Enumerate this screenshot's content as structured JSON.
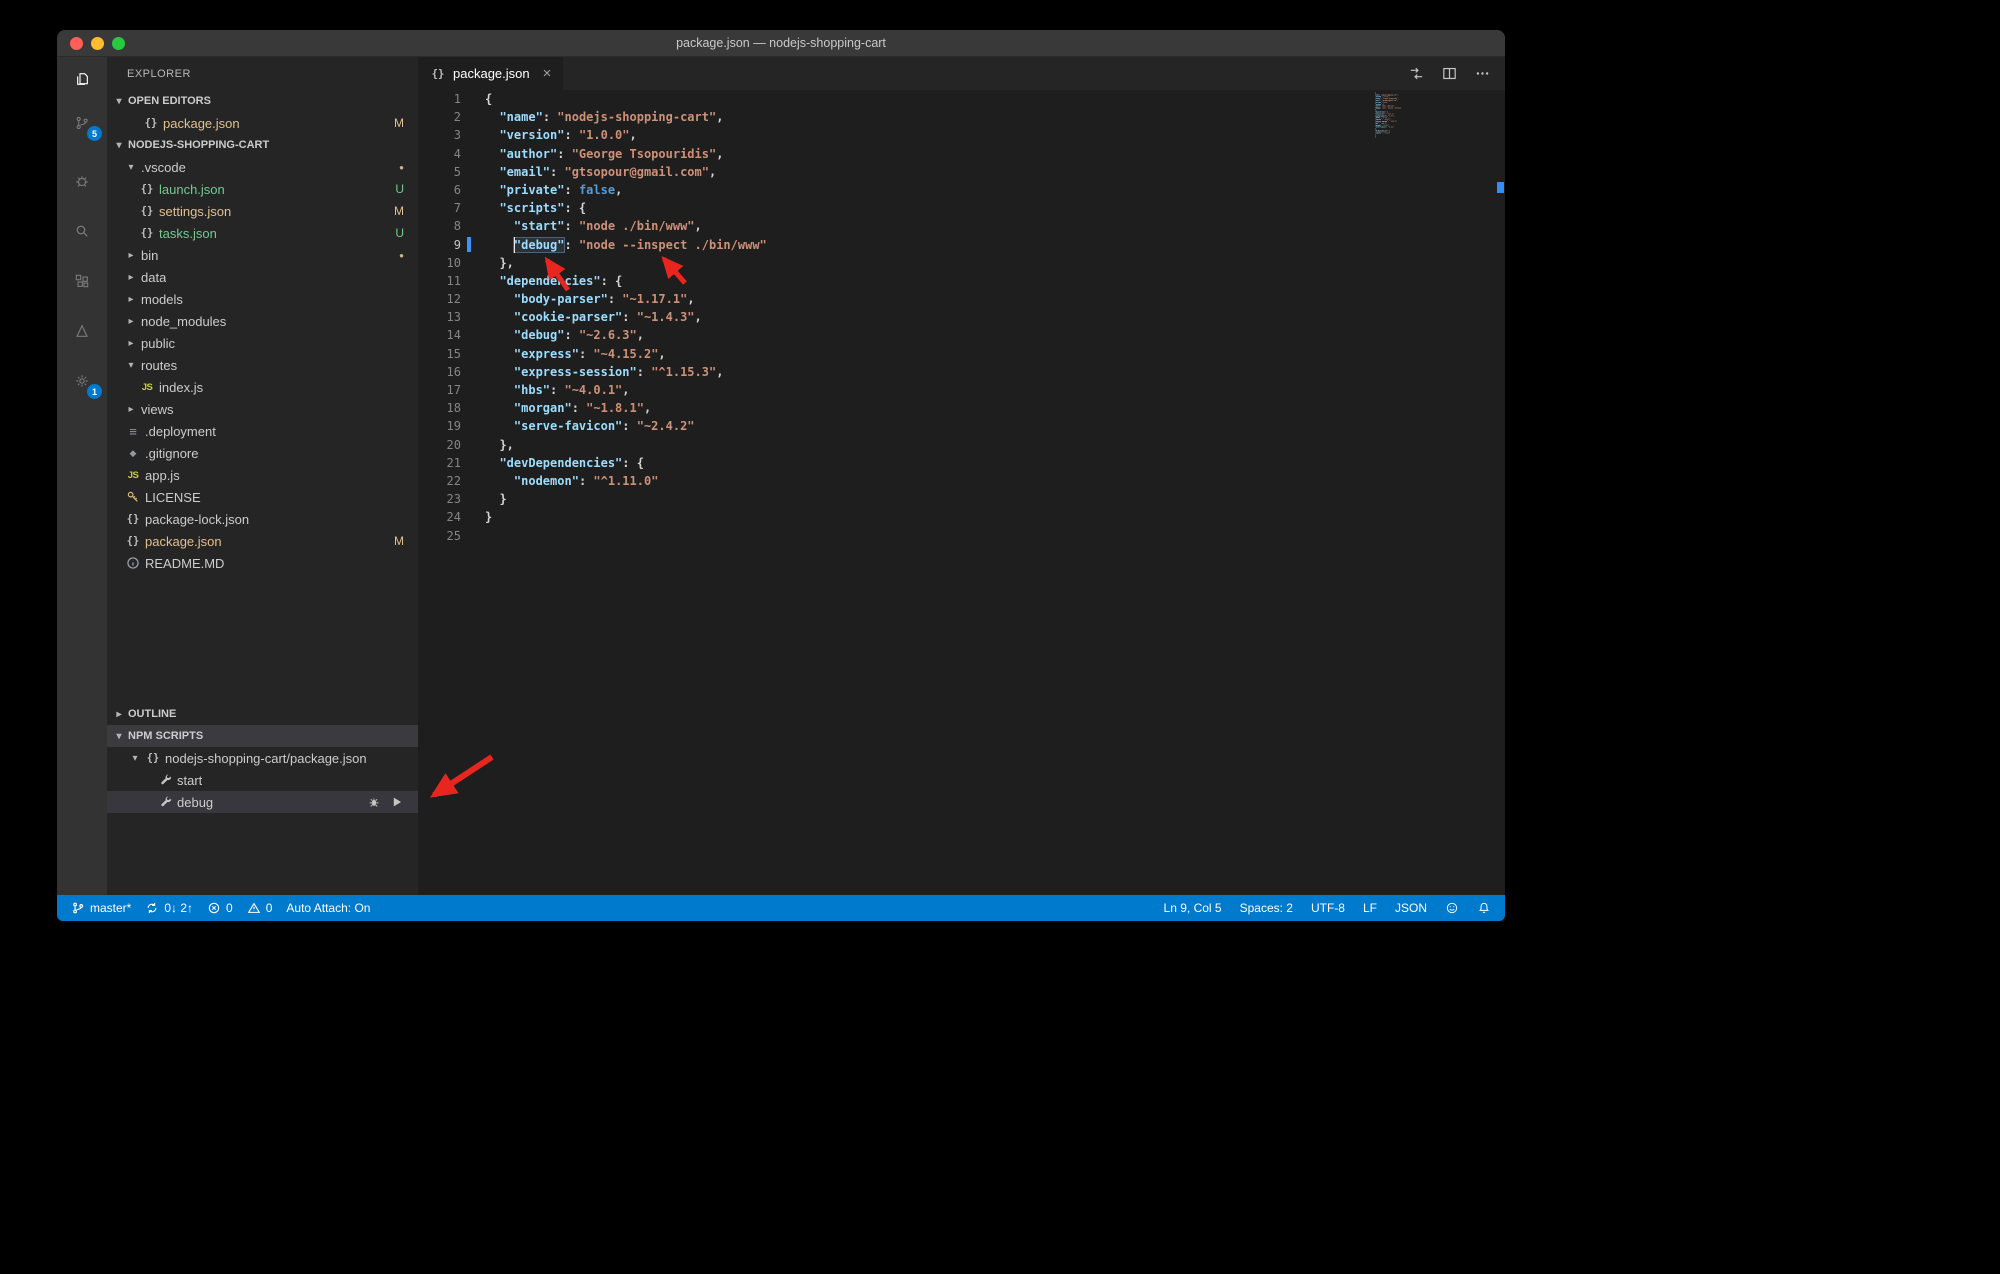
{
  "window": {
    "title": "package.json — nodejs-shopping-cart"
  },
  "activity_bar": {
    "items": [
      {
        "name": "explorer",
        "icon": "files-icon",
        "active": true
      },
      {
        "name": "source-control",
        "icon": "source-control-icon",
        "badge": "5"
      },
      {
        "name": "debug",
        "icon": "debug-icon"
      },
      {
        "name": "search",
        "icon": "search-icon"
      },
      {
        "name": "extensions",
        "icon": "extensions-icon"
      },
      {
        "name": "azure",
        "icon": "azure-icon"
      }
    ],
    "bottom": [
      {
        "name": "settings",
        "icon": "gear-icon",
        "badge": "1"
      }
    ]
  },
  "sidebar": {
    "title": "EXPLORER",
    "open_editors": {
      "label": "OPEN EDITORS",
      "items": [
        {
          "label": "package.json",
          "icon": "json",
          "badge": "M",
          "color": "modified"
        }
      ]
    },
    "project": {
      "label": "NODEJS-SHOPPING-CART",
      "items": [
        {
          "label": ".vscode",
          "type": "folder",
          "expanded": true,
          "indent": 0,
          "badge_dot": true
        },
        {
          "label": "launch.json",
          "icon": "json",
          "indent": 1,
          "badge": "U",
          "color": "untracked"
        },
        {
          "label": "settings.json",
          "icon": "json",
          "indent": 1,
          "badge": "M",
          "color": "modified"
        },
        {
          "label": "tasks.json",
          "icon": "json",
          "indent": 1,
          "badge": "U",
          "color": "untracked"
        },
        {
          "label": "bin",
          "type": "folder",
          "indent": 0,
          "badge_dot": true
        },
        {
          "label": "data",
          "type": "folder",
          "indent": 0
        },
        {
          "label": "models",
          "type": "folder",
          "indent": 0
        },
        {
          "label": "node_modules",
          "type": "folder",
          "indent": 0
        },
        {
          "label": "public",
          "type": "folder",
          "indent": 0
        },
        {
          "label": "routes",
          "type": "folder",
          "expanded": true,
          "indent": 0
        },
        {
          "label": "index.js",
          "icon": "js",
          "indent": 1
        },
        {
          "label": "views",
          "type": "folder",
          "indent": 0
        },
        {
          "label": ".deployment",
          "icon": "list",
          "indent": 0
        },
        {
          "label": ".gitignore",
          "icon": "diamond",
          "indent": 0
        },
        {
          "label": "app.js",
          "icon": "js",
          "indent": 0
        },
        {
          "label": "LICENSE",
          "icon": "key",
          "indent": 0
        },
        {
          "label": "package-lock.json",
          "icon": "json",
          "indent": 0
        },
        {
          "label": "package.json",
          "icon": "json",
          "indent": 0,
          "badge": "M",
          "color": "modified"
        },
        {
          "label": "README.MD",
          "icon": "info",
          "indent": 0
        }
      ]
    },
    "outline": {
      "label": "OUTLINE"
    },
    "npm_scripts": {
      "label": "NPM SCRIPTS",
      "items": [
        {
          "label": "nodejs-shopping-cart/package.json",
          "icon": "json",
          "expandable": true,
          "expanded": true,
          "indent": 0
        },
        {
          "label": "start",
          "icon": "wrench",
          "indent": 1
        },
        {
          "label": "debug",
          "icon": "wrench",
          "indent": 1,
          "selected": true,
          "actions": [
            "bug-icon",
            "play-icon"
          ]
        }
      ]
    }
  },
  "editor": {
    "tab": {
      "label": "package.json",
      "icon": "json",
      "close": "×"
    },
    "actions": [
      "open-changes-icon",
      "split-editor-icon",
      "more-icon"
    ],
    "active_line": 9,
    "cursor": {
      "line": 9,
      "col": 5
    },
    "lines": [
      {
        "n": 1,
        "t": [
          [
            "p",
            "{"
          ]
        ]
      },
      {
        "n": 2,
        "t": [
          [
            "p",
            "  "
          ],
          [
            "k",
            "\"name\""
          ],
          [
            "p",
            ": "
          ],
          [
            "s",
            "\"nodejs-shopping-cart\""
          ],
          [
            "p",
            ","
          ]
        ]
      },
      {
        "n": 3,
        "t": [
          [
            "p",
            "  "
          ],
          [
            "k",
            "\"version\""
          ],
          [
            "p",
            ": "
          ],
          [
            "s",
            "\"1.0.0\""
          ],
          [
            "p",
            ","
          ]
        ]
      },
      {
        "n": 4,
        "t": [
          [
            "p",
            "  "
          ],
          [
            "k",
            "\"author\""
          ],
          [
            "p",
            ": "
          ],
          [
            "s",
            "\"George Tsopouridis\""
          ],
          [
            "p",
            ","
          ]
        ]
      },
      {
        "n": 5,
        "t": [
          [
            "p",
            "  "
          ],
          [
            "k",
            "\"email\""
          ],
          [
            "p",
            ": "
          ],
          [
            "s",
            "\"gtsopour@gmail.com\""
          ],
          [
            "p",
            ","
          ]
        ]
      },
      {
        "n": 6,
        "t": [
          [
            "p",
            "  "
          ],
          [
            "k",
            "\"private\""
          ],
          [
            "p",
            ": "
          ],
          [
            "b",
            "false"
          ],
          [
            "p",
            ","
          ]
        ]
      },
      {
        "n": 7,
        "t": [
          [
            "p",
            "  "
          ],
          [
            "k",
            "\"scripts\""
          ],
          [
            "p",
            ": {"
          ]
        ]
      },
      {
        "n": 8,
        "t": [
          [
            "p",
            "    "
          ],
          [
            "k",
            "\"start\""
          ],
          [
            "p",
            ": "
          ],
          [
            "s",
            "\"node ./bin/www\""
          ],
          [
            "p",
            ","
          ]
        ]
      },
      {
        "n": 9,
        "t": [
          [
            "p",
            "    "
          ],
          [
            "k",
            "\"debug\"",
            "hl"
          ],
          [
            "p",
            ": "
          ],
          [
            "s",
            "\"node --inspect ./bin/www\""
          ]
        ]
      },
      {
        "n": 10,
        "t": [
          [
            "p",
            "  },"
          ]
        ]
      },
      {
        "n": 11,
        "t": [
          [
            "p",
            "  "
          ],
          [
            "k",
            "\"dependencies\""
          ],
          [
            "p",
            ": {"
          ]
        ]
      },
      {
        "n": 12,
        "t": [
          [
            "p",
            "    "
          ],
          [
            "k",
            "\"body-parser\""
          ],
          [
            "p",
            ": "
          ],
          [
            "s",
            "\"~1.17.1\""
          ],
          [
            "p",
            ","
          ]
        ]
      },
      {
        "n": 13,
        "t": [
          [
            "p",
            "    "
          ],
          [
            "k",
            "\"cookie-parser\""
          ],
          [
            "p",
            ": "
          ],
          [
            "s",
            "\"~1.4.3\""
          ],
          [
            "p",
            ","
          ]
        ]
      },
      {
        "n": 14,
        "t": [
          [
            "p",
            "    "
          ],
          [
            "k",
            "\"debug\""
          ],
          [
            "p",
            ": "
          ],
          [
            "s",
            "\"~2.6.3\""
          ],
          [
            "p",
            ","
          ]
        ]
      },
      {
        "n": 15,
        "t": [
          [
            "p",
            "    "
          ],
          [
            "k",
            "\"express\""
          ],
          [
            "p",
            ": "
          ],
          [
            "s",
            "\"~4.15.2\""
          ],
          [
            "p",
            ","
          ]
        ]
      },
      {
        "n": 16,
        "t": [
          [
            "p",
            "    "
          ],
          [
            "k",
            "\"express-session\""
          ],
          [
            "p",
            ": "
          ],
          [
            "s",
            "\"^1.15.3\""
          ],
          [
            "p",
            ","
          ]
        ]
      },
      {
        "n": 17,
        "t": [
          [
            "p",
            "    "
          ],
          [
            "k",
            "\"hbs\""
          ],
          [
            "p",
            ": "
          ],
          [
            "s",
            "\"~4.0.1\""
          ],
          [
            "p",
            ","
          ]
        ]
      },
      {
        "n": 18,
        "t": [
          [
            "p",
            "    "
          ],
          [
            "k",
            "\"morgan\""
          ],
          [
            "p",
            ": "
          ],
          [
            "s",
            "\"~1.8.1\""
          ],
          [
            "p",
            ","
          ]
        ]
      },
      {
        "n": 19,
        "t": [
          [
            "p",
            "    "
          ],
          [
            "k",
            "\"serve-favicon\""
          ],
          [
            "p",
            ": "
          ],
          [
            "s",
            "\"~2.4.2\""
          ]
        ]
      },
      {
        "n": 20,
        "t": [
          [
            "p",
            "  },"
          ]
        ]
      },
      {
        "n": 21,
        "t": [
          [
            "p",
            "  "
          ],
          [
            "k",
            "\"devDependencies\""
          ],
          [
            "p",
            ": {"
          ]
        ]
      },
      {
        "n": 22,
        "t": [
          [
            "p",
            "    "
          ],
          [
            "k",
            "\"nodemon\""
          ],
          [
            "p",
            ": "
          ],
          [
            "s",
            "\"^1.11.0\""
          ]
        ]
      },
      {
        "n": 23,
        "t": [
          [
            "p",
            "  }"
          ]
        ]
      },
      {
        "n": 24,
        "t": [
          [
            "p",
            "}"
          ]
        ]
      },
      {
        "n": 25,
        "t": []
      }
    ]
  },
  "status_bar": {
    "left": [
      {
        "name": "git-branch",
        "icon": "branch-icon",
        "text": "master*"
      },
      {
        "name": "sync-status",
        "icon": "sync-icon",
        "text": "0↓ 2↑"
      },
      {
        "name": "errors",
        "icon": "error-icon",
        "text": "0"
      },
      {
        "name": "warnings",
        "icon": "warning-icon",
        "text": "0"
      },
      {
        "name": "auto-attach",
        "text": "Auto Attach: On"
      }
    ],
    "right": [
      {
        "name": "cursor-position",
        "text": "Ln 9, Col 5"
      },
      {
        "name": "indentation",
        "text": "Spaces: 2"
      },
      {
        "name": "encoding",
        "text": "UTF-8"
      },
      {
        "name": "eol",
        "text": "LF"
      },
      {
        "name": "language-mode",
        "text": "JSON"
      },
      {
        "name": "feedback",
        "icon": "smiley-icon"
      },
      {
        "name": "notifications",
        "icon": "bell-icon"
      }
    ]
  },
  "colors": {
    "accent": "#007acc",
    "modified_badge": "#e2c08d",
    "untracked_badge": "#73c991",
    "arrow_annotation": "#e8261f",
    "key_token": "#9cdcfe",
    "string_token": "#ce9178",
    "keyword_token": "#569cd6"
  }
}
